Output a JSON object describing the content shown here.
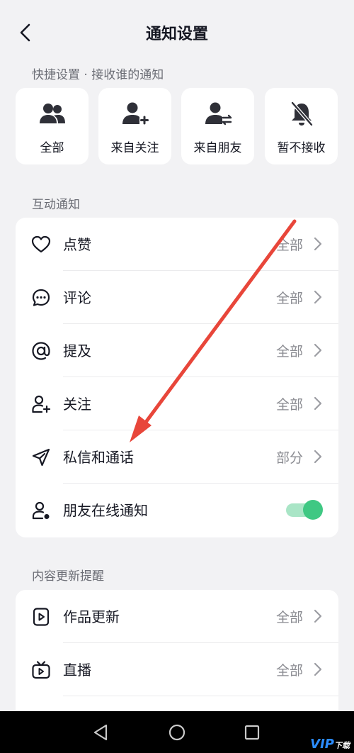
{
  "header": {
    "title": "通知设置"
  },
  "quick_settings": {
    "label": "快捷设置 · 接收谁的通知",
    "options": [
      {
        "label": "全部",
        "icon": "group-icon"
      },
      {
        "label": "来自关注",
        "icon": "person-add-icon"
      },
      {
        "label": "来自朋友",
        "icon": "person-swap-icon"
      },
      {
        "label": "暂不接收",
        "icon": "bell-off-icon"
      }
    ]
  },
  "interaction": {
    "label": "互动通知",
    "items": [
      {
        "label": "点赞",
        "value": "全部",
        "icon": "heart-icon"
      },
      {
        "label": "评论",
        "value": "全部",
        "icon": "comment-icon"
      },
      {
        "label": "提及",
        "value": "全部",
        "icon": "at-icon"
      },
      {
        "label": "关注",
        "value": "全部",
        "icon": "follow-icon"
      },
      {
        "label": "私信和通话",
        "value": "部分",
        "icon": "send-icon"
      },
      {
        "label": "朋友在线通知",
        "toggle": true,
        "icon": "friend-online-icon"
      }
    ]
  },
  "content_updates": {
    "label": "内容更新提醒",
    "items": [
      {
        "label": "作品更新",
        "value": "全部",
        "icon": "video-icon"
      },
      {
        "label": "直播",
        "value": "全部",
        "icon": "live-tv-icon"
      }
    ]
  },
  "colors": {
    "toggle_on": "#3fc883",
    "annotation_arrow": "#e8463a"
  },
  "watermark": {
    "brand": "VIP",
    "text": "下载"
  }
}
